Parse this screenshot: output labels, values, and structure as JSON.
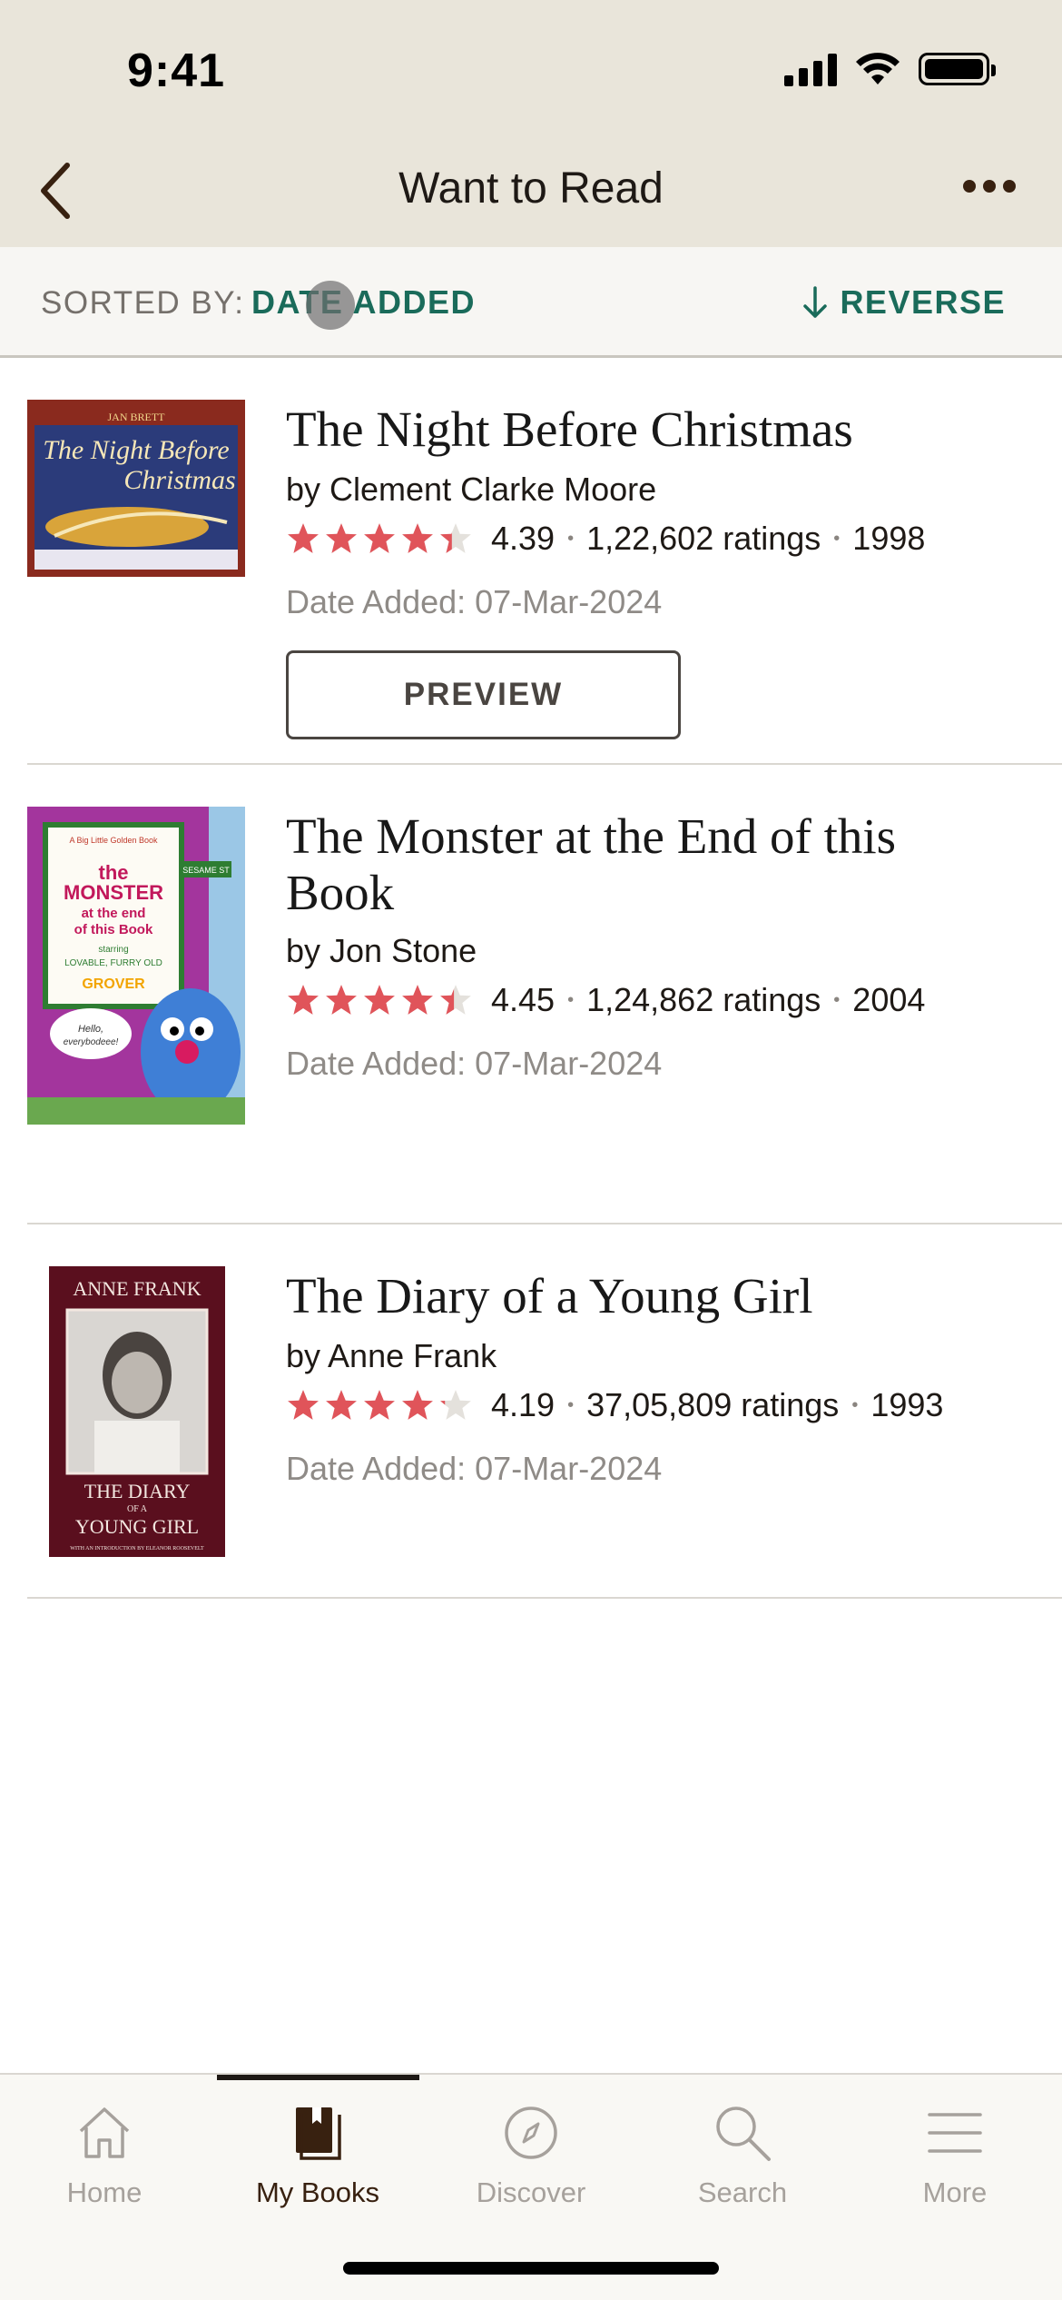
{
  "status_bar": {
    "time": "9:41"
  },
  "header": {
    "title": "Want to Read"
  },
  "sort_bar": {
    "label": "SORTED BY:",
    "value": "DATE ADDED",
    "reverse_label": "REVERSE"
  },
  "books": [
    {
      "title": "The Night Before Christmas",
      "author": "by Clement Clarke Moore",
      "rating": "4.39",
      "rating_value": 4.39,
      "ratings_count": "1,22,602 ratings",
      "year": "1998",
      "date_added": "Date Added: 07-Mar-2024",
      "preview_label": "PREVIEW",
      "cover": {
        "top_text": "JAN BRETT",
        "title_text": "The Night Before Christmas"
      }
    },
    {
      "title": "The Monster at the End of this Book",
      "author": "by Jon Stone",
      "rating": "4.45",
      "rating_value": 4.45,
      "ratings_count": "1,24,862 ratings",
      "year": "2004",
      "date_added": "Date Added: 07-Mar-2024",
      "cover": {
        "top_text": "A Big Little Golden Book",
        "title_text": "the MONSTER at the end of this Book",
        "sub_text": "starring LOVABLE, FURRY OLD",
        "grover": "GROVER",
        "sign": "SESAME ST",
        "bubble": "Hello, everybodeee!"
      }
    },
    {
      "title": "The Diary of a Young Girl",
      "author": "by Anne Frank",
      "rating": "4.19",
      "rating_value": 4.19,
      "ratings_count": "37,05,809 ratings",
      "year": "1993",
      "date_added": "Date Added: 07-Mar-2024",
      "cover": {
        "author_text": "ANNE FRANK",
        "title_text": "THE DIARY OF A YOUNG GIRL",
        "intro_text": "WITH AN INTRODUCTION BY ELEANOR ROOSEVELT"
      }
    }
  ],
  "tab_bar": {
    "tabs": [
      {
        "label": "Home",
        "icon": "home-icon"
      },
      {
        "label": "My Books",
        "icon": "book-icon"
      },
      {
        "label": "Discover",
        "icon": "compass-icon"
      },
      {
        "label": "Search",
        "icon": "search-icon"
      },
      {
        "label": "More",
        "icon": "menu-icon"
      }
    ],
    "active_index": 1
  },
  "colors": {
    "accent": "#1a6b5a",
    "star": "#e0545a",
    "header_bg": "#e9e5da"
  }
}
